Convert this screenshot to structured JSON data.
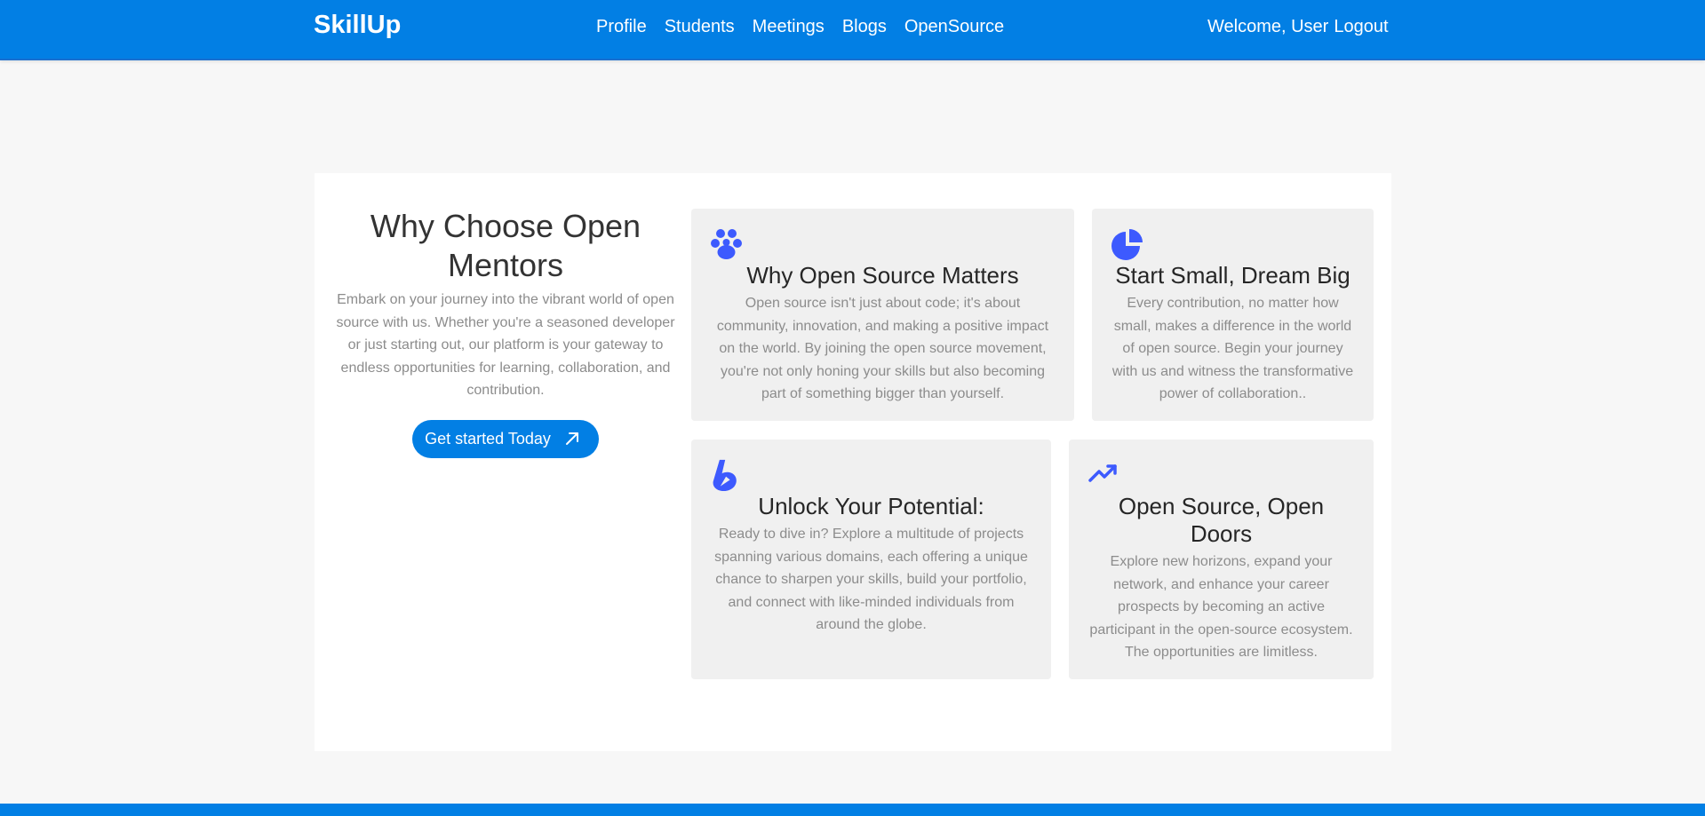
{
  "nav": {
    "brand": "SkillUp",
    "links": [
      "Profile",
      "Students",
      "Meetings",
      "Blogs",
      "OpenSource"
    ],
    "welcome": "Welcome, User",
    "logout": "Logout"
  },
  "intro": {
    "title": "Why Choose Open Mentors",
    "description": "Embark on your journey into the vibrant world of open source with us. Whether you're a seasoned developer or just starting out, our platform is your gateway to endless opportunities for learning, collaboration, and contribution.",
    "cta_label": "Get started Today"
  },
  "features": [
    {
      "icon": "paw-icon",
      "title": "Why Open Source Matters",
      "text": "Open source isn't just about code; it's about community, innovation, and making a positive impact on the world. By joining the open source movement, you're not only honing your skills but also becoming part of something bigger than yourself."
    },
    {
      "icon": "pie-chart-icon",
      "title": "Start Small, Dream Big",
      "text": "Every contribution, no matter how small, makes a difference in the world of open source. Begin your journey with us and witness the transformative power of collaboration.."
    },
    {
      "icon": "lightning-icon",
      "title": "Unlock Your Potential:",
      "text": "Ready to dive in? Explore a multitude of projects spanning various domains, each offering a unique chance to sharpen your skills, build your portfolio, and connect with like-minded individuals from around the globe."
    },
    {
      "icon": "trending-up-icon",
      "title": "Open Source, Open Doors",
      "text": "Explore new horizons, expand your network, and enhance your career prospects by becoming an active participant in the open-source ecosystem. The opportunities are limitless."
    }
  ],
  "colors": {
    "primary": "#027fe4",
    "icon": "#3d5afe",
    "card_bg": "#f0f0f0",
    "page_bg": "#f7f7f7"
  }
}
